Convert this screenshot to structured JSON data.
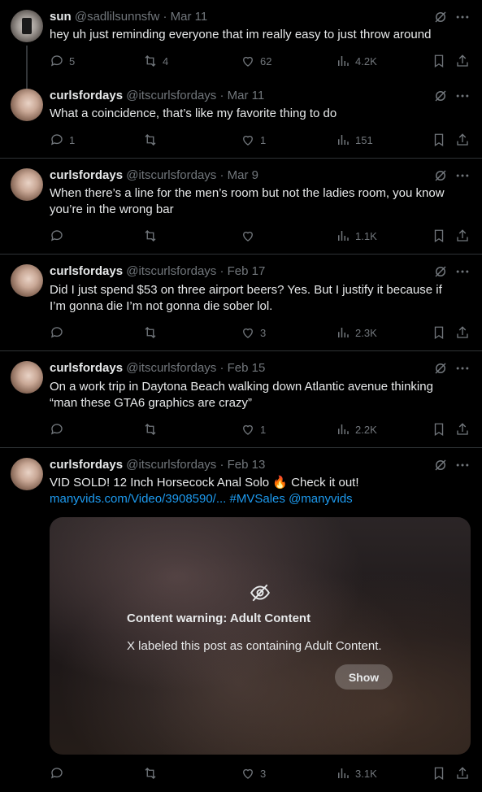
{
  "tweets": [
    {
      "name": "sun",
      "handle": "@sadlilsunnsfw",
      "date": "· Mar 11",
      "text": "hey uh just reminding everyone that im really easy to just throw around",
      "replies": "5",
      "reposts": "4",
      "likes": "62",
      "views": "4.2K"
    },
    {
      "name": "curlsfordays",
      "handle": "@itscurlsfordays",
      "date": "· Mar 11",
      "text": "What a coincidence, that’s like my favorite thing to do",
      "replies": "1",
      "reposts": "",
      "likes": "1",
      "views": "151"
    },
    {
      "name": "curlsfordays",
      "handle": "@itscurlsfordays",
      "date": "· Mar 9",
      "text_line1": "When there’s a line for the men’s room but not the ladies room, you know",
      "text_line2": "you’re in the wrong bar",
      "replies": "",
      "reposts": "",
      "likes": "",
      "views": "1.1K"
    },
    {
      "name": "curlsfordays",
      "handle": "@itscurlsfordays",
      "date": "· Feb 17",
      "text_line1": "Did I just spend $53 on three airport beers? Yes. But I justify it because if",
      "text_line2": "I’m gonna die I’m not gonna die sober lol.",
      "replies": "",
      "reposts": "",
      "likes": "3",
      "views": "2.3K"
    },
    {
      "name": "curlsfordays",
      "handle": "@itscurlsfordays",
      "date": "· Feb 15",
      "text_line1": "On a work trip in Daytona Beach walking down Atlantic avenue thinking",
      "text_line2": "“man these GTA6 graphics are crazy”",
      "replies": "",
      "reposts": "",
      "likes": "1",
      "views": "2.2K"
    },
    {
      "name": "curlsfordays",
      "handle": "@itscurlsfordays",
      "date": "· Feb 13",
      "text_line1": "VID SOLD! 12 Inch Horsecock Anal Solo 🔥 Check it out!",
      "link_url": "manyvids.com/Video/3908590/...",
      "link_hashtag": "#MVSales",
      "link_mention": "@manyvids",
      "content_warning_title": "Content warning: Adult Content",
      "content_warning_desc": "X labeled this post as containing Adult Content.",
      "show_label": "Show",
      "replies": "",
      "reposts": "",
      "likes": "3",
      "views": "3.1K"
    }
  ],
  "colors": {
    "background": "#000000",
    "text": "#e7e9ea",
    "muted": "#71767b",
    "link": "#1d9bf0",
    "divider": "#2f3336"
  },
  "icons": [
    "grok-icon",
    "more-icon",
    "reply-icon",
    "repost-icon",
    "like-icon",
    "views-icon",
    "bookmark-icon",
    "share-icon",
    "eye-slash-icon"
  ]
}
